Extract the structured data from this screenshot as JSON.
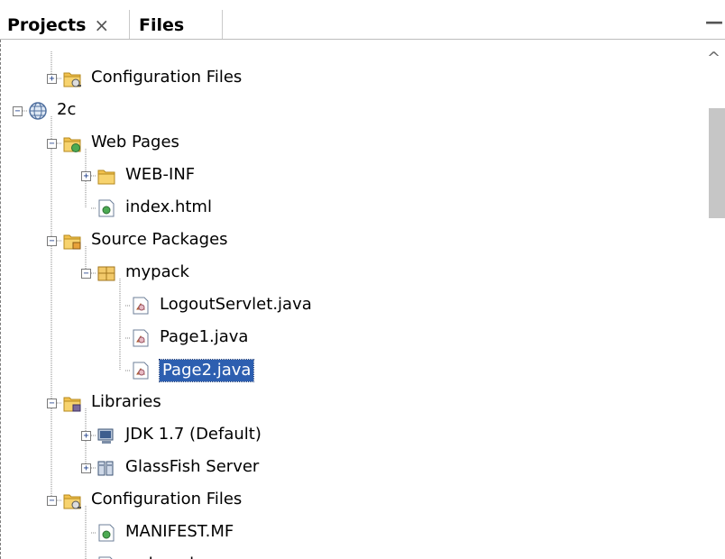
{
  "tabs": {
    "projects_label": "Projects",
    "close_glyph": "×",
    "files_label": "Files",
    "minimize_glyph": "—"
  },
  "tree": [
    {
      "label": "Configuration Files",
      "icon": "config-folder-icon",
      "expander": "+"
    },
    {
      "label": "2c",
      "icon": "globe-project-icon",
      "expander": "-"
    },
    {
      "label": "Web Pages",
      "icon": "web-folder-icon",
      "expander": "-"
    },
    {
      "label": "WEB-INF",
      "icon": "folder-icon",
      "expander": "+"
    },
    {
      "label": "index.html",
      "icon": "html-file-icon",
      "expander": ""
    },
    {
      "label": "Source Packages",
      "icon": "source-folder-icon",
      "expander": "-"
    },
    {
      "label": "mypack",
      "icon": "package-icon",
      "expander": "-"
    },
    {
      "label": "LogoutServlet.java",
      "icon": "java-file-icon",
      "expander": ""
    },
    {
      "label": "Page1.java",
      "icon": "java-file-icon",
      "expander": ""
    },
    {
      "label": "Page2.java",
      "icon": "java-file-icon",
      "expander": "",
      "selected": true
    },
    {
      "label": "Libraries",
      "icon": "library-folder-icon",
      "expander": "-"
    },
    {
      "label": "JDK 1.7 (Default)",
      "icon": "jdk-icon",
      "expander": "+"
    },
    {
      "label": "GlassFish Server",
      "icon": "server-library-icon",
      "expander": "+"
    },
    {
      "label": "Configuration Files",
      "icon": "config-folder-icon",
      "expander": "-"
    },
    {
      "label": "MANIFEST.MF",
      "icon": "manifest-file-icon",
      "expander": ""
    },
    {
      "label": "web.xml",
      "icon": "xml-file-icon",
      "expander": ""
    }
  ],
  "scrollbar": {
    "up_glyph": "^"
  },
  "colors": {
    "selection": "#2d5fb0",
    "folder": "#f2c14e"
  }
}
